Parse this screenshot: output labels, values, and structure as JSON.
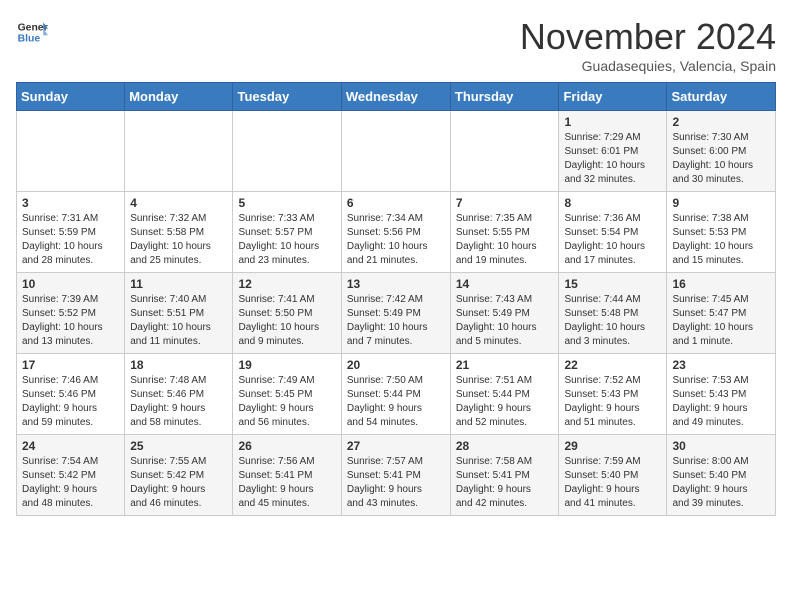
{
  "header": {
    "logo_general": "General",
    "logo_blue": "Blue",
    "month_title": "November 2024",
    "subtitle": "Guadasequies, Valencia, Spain"
  },
  "days_of_week": [
    "Sunday",
    "Monday",
    "Tuesday",
    "Wednesday",
    "Thursday",
    "Friday",
    "Saturday"
  ],
  "weeks": [
    [
      {
        "day": "",
        "info": ""
      },
      {
        "day": "",
        "info": ""
      },
      {
        "day": "",
        "info": ""
      },
      {
        "day": "",
        "info": ""
      },
      {
        "day": "",
        "info": ""
      },
      {
        "day": "1",
        "info": "Sunrise: 7:29 AM\nSunset: 6:01 PM\nDaylight: 10 hours\nand 32 minutes."
      },
      {
        "day": "2",
        "info": "Sunrise: 7:30 AM\nSunset: 6:00 PM\nDaylight: 10 hours\nand 30 minutes."
      }
    ],
    [
      {
        "day": "3",
        "info": "Sunrise: 7:31 AM\nSunset: 5:59 PM\nDaylight: 10 hours\nand 28 minutes."
      },
      {
        "day": "4",
        "info": "Sunrise: 7:32 AM\nSunset: 5:58 PM\nDaylight: 10 hours\nand 25 minutes."
      },
      {
        "day": "5",
        "info": "Sunrise: 7:33 AM\nSunset: 5:57 PM\nDaylight: 10 hours\nand 23 minutes."
      },
      {
        "day": "6",
        "info": "Sunrise: 7:34 AM\nSunset: 5:56 PM\nDaylight: 10 hours\nand 21 minutes."
      },
      {
        "day": "7",
        "info": "Sunrise: 7:35 AM\nSunset: 5:55 PM\nDaylight: 10 hours\nand 19 minutes."
      },
      {
        "day": "8",
        "info": "Sunrise: 7:36 AM\nSunset: 5:54 PM\nDaylight: 10 hours\nand 17 minutes."
      },
      {
        "day": "9",
        "info": "Sunrise: 7:38 AM\nSunset: 5:53 PM\nDaylight: 10 hours\nand 15 minutes."
      }
    ],
    [
      {
        "day": "10",
        "info": "Sunrise: 7:39 AM\nSunset: 5:52 PM\nDaylight: 10 hours\nand 13 minutes."
      },
      {
        "day": "11",
        "info": "Sunrise: 7:40 AM\nSunset: 5:51 PM\nDaylight: 10 hours\nand 11 minutes."
      },
      {
        "day": "12",
        "info": "Sunrise: 7:41 AM\nSunset: 5:50 PM\nDaylight: 10 hours\nand 9 minutes."
      },
      {
        "day": "13",
        "info": "Sunrise: 7:42 AM\nSunset: 5:49 PM\nDaylight: 10 hours\nand 7 minutes."
      },
      {
        "day": "14",
        "info": "Sunrise: 7:43 AM\nSunset: 5:49 PM\nDaylight: 10 hours\nand 5 minutes."
      },
      {
        "day": "15",
        "info": "Sunrise: 7:44 AM\nSunset: 5:48 PM\nDaylight: 10 hours\nand 3 minutes."
      },
      {
        "day": "16",
        "info": "Sunrise: 7:45 AM\nSunset: 5:47 PM\nDaylight: 10 hours\nand 1 minute."
      }
    ],
    [
      {
        "day": "17",
        "info": "Sunrise: 7:46 AM\nSunset: 5:46 PM\nDaylight: 9 hours\nand 59 minutes."
      },
      {
        "day": "18",
        "info": "Sunrise: 7:48 AM\nSunset: 5:46 PM\nDaylight: 9 hours\nand 58 minutes."
      },
      {
        "day": "19",
        "info": "Sunrise: 7:49 AM\nSunset: 5:45 PM\nDaylight: 9 hours\nand 56 minutes."
      },
      {
        "day": "20",
        "info": "Sunrise: 7:50 AM\nSunset: 5:44 PM\nDaylight: 9 hours\nand 54 minutes."
      },
      {
        "day": "21",
        "info": "Sunrise: 7:51 AM\nSunset: 5:44 PM\nDaylight: 9 hours\nand 52 minutes."
      },
      {
        "day": "22",
        "info": "Sunrise: 7:52 AM\nSunset: 5:43 PM\nDaylight: 9 hours\nand 51 minutes."
      },
      {
        "day": "23",
        "info": "Sunrise: 7:53 AM\nSunset: 5:43 PM\nDaylight: 9 hours\nand 49 minutes."
      }
    ],
    [
      {
        "day": "24",
        "info": "Sunrise: 7:54 AM\nSunset: 5:42 PM\nDaylight: 9 hours\nand 48 minutes."
      },
      {
        "day": "25",
        "info": "Sunrise: 7:55 AM\nSunset: 5:42 PM\nDaylight: 9 hours\nand 46 minutes."
      },
      {
        "day": "26",
        "info": "Sunrise: 7:56 AM\nSunset: 5:41 PM\nDaylight: 9 hours\nand 45 minutes."
      },
      {
        "day": "27",
        "info": "Sunrise: 7:57 AM\nSunset: 5:41 PM\nDaylight: 9 hours\nand 43 minutes."
      },
      {
        "day": "28",
        "info": "Sunrise: 7:58 AM\nSunset: 5:41 PM\nDaylight: 9 hours\nand 42 minutes."
      },
      {
        "day": "29",
        "info": "Sunrise: 7:59 AM\nSunset: 5:40 PM\nDaylight: 9 hours\nand 41 minutes."
      },
      {
        "day": "30",
        "info": "Sunrise: 8:00 AM\nSunset: 5:40 PM\nDaylight: 9 hours\nand 39 minutes."
      }
    ]
  ]
}
